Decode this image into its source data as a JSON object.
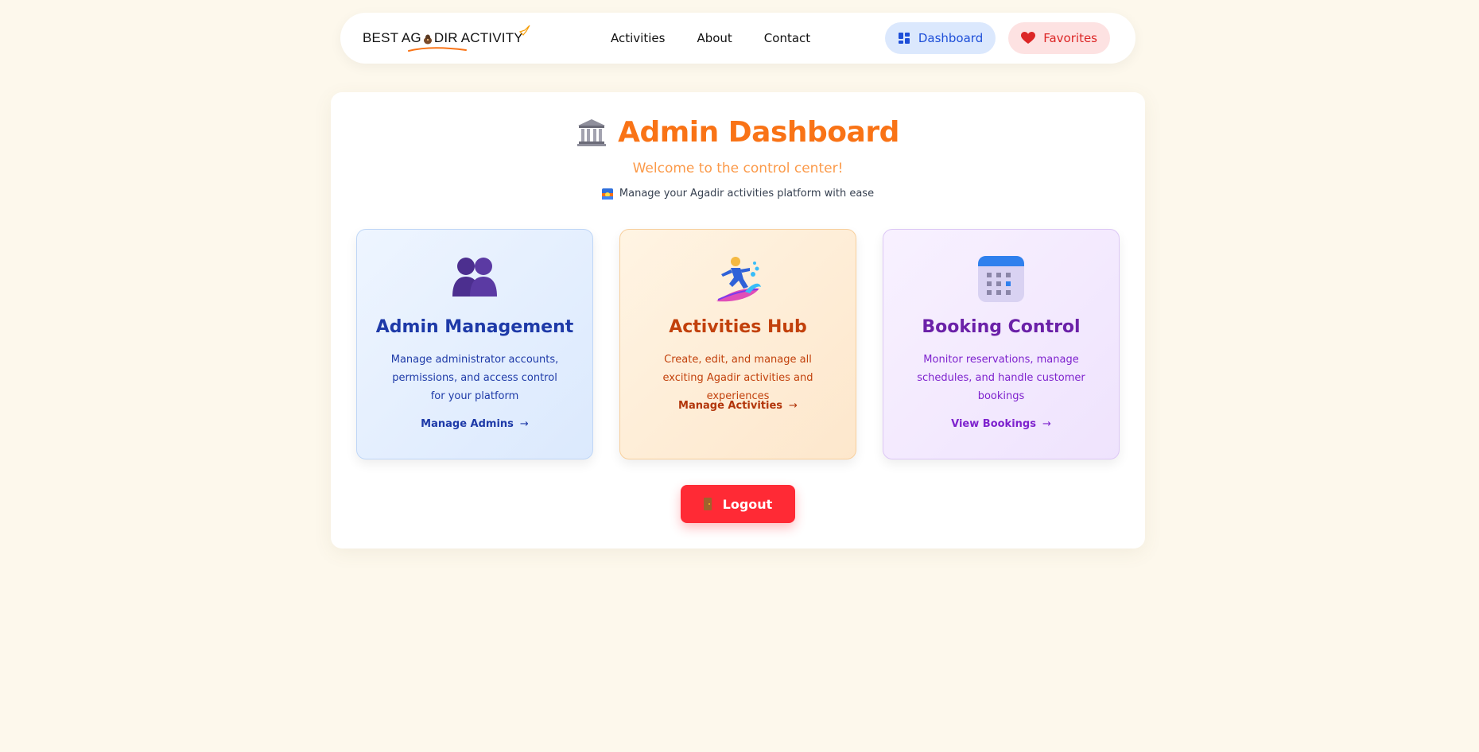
{
  "navbar": {
    "logo_text": "BEST AG",
    "logo_text_end": "DIR ACTIVITY",
    "links": [
      {
        "label": "Activities"
      },
      {
        "label": "About"
      },
      {
        "label": "Contact"
      }
    ],
    "dashboard_label": "Dashboard",
    "favorites_label": "Favorites"
  },
  "main": {
    "title": "Admin Dashboard",
    "subtitle": "Welcome to the control center!",
    "tagline": "Manage your Agadir activities platform with ease",
    "cards": [
      {
        "title": "Admin Management",
        "description": "Manage administrator accounts, permissions, and access control for your platform",
        "link": "Manage Admins",
        "icon": "people-icon"
      },
      {
        "title": "Activities Hub",
        "description": "Create, edit, and manage all exciting Agadir activities and experiences",
        "link": "Manage Activities",
        "icon": "surfer-icon"
      },
      {
        "title": "Booking Control",
        "description": "Monitor reservations, manage schedules, and handle customer bookings",
        "link": "View Bookings",
        "icon": "calendar-icon"
      }
    ],
    "arrow": "→",
    "logout_label": "Logout"
  },
  "colors": {
    "page_bg": "#fdf8ec",
    "accent_orange": "#f97316",
    "logout_red": "#ff2a35",
    "dashboard_blue": "#1d4ed8",
    "favorites_red": "#dc2626"
  }
}
